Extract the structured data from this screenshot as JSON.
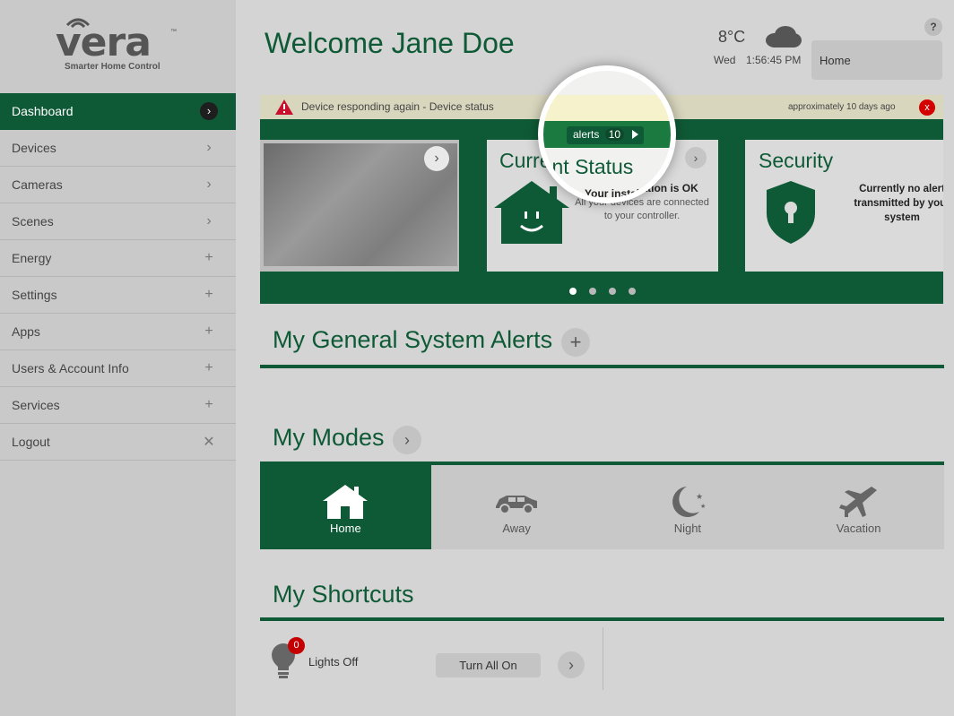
{
  "brand": {
    "logo_text": "vera",
    "tm": "™",
    "tagline": "Smarter Home Control"
  },
  "sidebar": {
    "items": [
      {
        "label": "Dashboard",
        "icon": "chevron-right-icon",
        "glyph": "›"
      },
      {
        "label": "Devices",
        "icon": "chevron-right-icon",
        "glyph": "›"
      },
      {
        "label": "Cameras",
        "icon": "chevron-right-icon",
        "glyph": "›"
      },
      {
        "label": "Scenes",
        "icon": "chevron-right-icon",
        "glyph": "›"
      },
      {
        "label": "Energy",
        "icon": "plus-icon",
        "glyph": "+"
      },
      {
        "label": "Settings",
        "icon": "plus-icon",
        "glyph": "+"
      },
      {
        "label": "Apps",
        "icon": "plus-icon",
        "glyph": "+"
      },
      {
        "label": "Users & Account Info",
        "icon": "plus-icon",
        "glyph": "+"
      },
      {
        "label": "Services",
        "icon": "plus-icon",
        "glyph": "+"
      },
      {
        "label": "Logout",
        "icon": "close-icon",
        "glyph": "✕"
      }
    ]
  },
  "header": {
    "welcome": "Welcome Jane Doe",
    "temperature": "8°C",
    "day": "Wed",
    "time": "1:56:45 PM",
    "mode": "Home",
    "help": "?"
  },
  "notification": {
    "text": "Device responding again - Device status",
    "time": "approximately 10 days ago",
    "close": "x"
  },
  "alerts": {
    "label": "alerts",
    "count": "10"
  },
  "carousel": {
    "status": {
      "title": "Current Status",
      "heading": "Your installation is OK",
      "body": "All your devices are connected to your controller."
    },
    "security": {
      "title": "Security",
      "body": "Currently no alert transmitted by your system"
    },
    "dots": 4,
    "active_dot": 0
  },
  "sections": {
    "alerts_title": "My General System Alerts",
    "modes_title": "My Modes",
    "shortcuts_title": "My Shortcuts"
  },
  "modes": [
    {
      "label": "Home",
      "icon": "home-icon"
    },
    {
      "label": "Away",
      "icon": "car-icon"
    },
    {
      "label": "Night",
      "icon": "moon-icon"
    },
    {
      "label": "Vacation",
      "icon": "airplane-icon"
    }
  ],
  "shortcuts": {
    "item_label": "Lights Off",
    "badge": "0",
    "button": "Turn All On"
  },
  "colors": {
    "brand_green": "#0f5a36",
    "alert_red": "#d40000"
  }
}
